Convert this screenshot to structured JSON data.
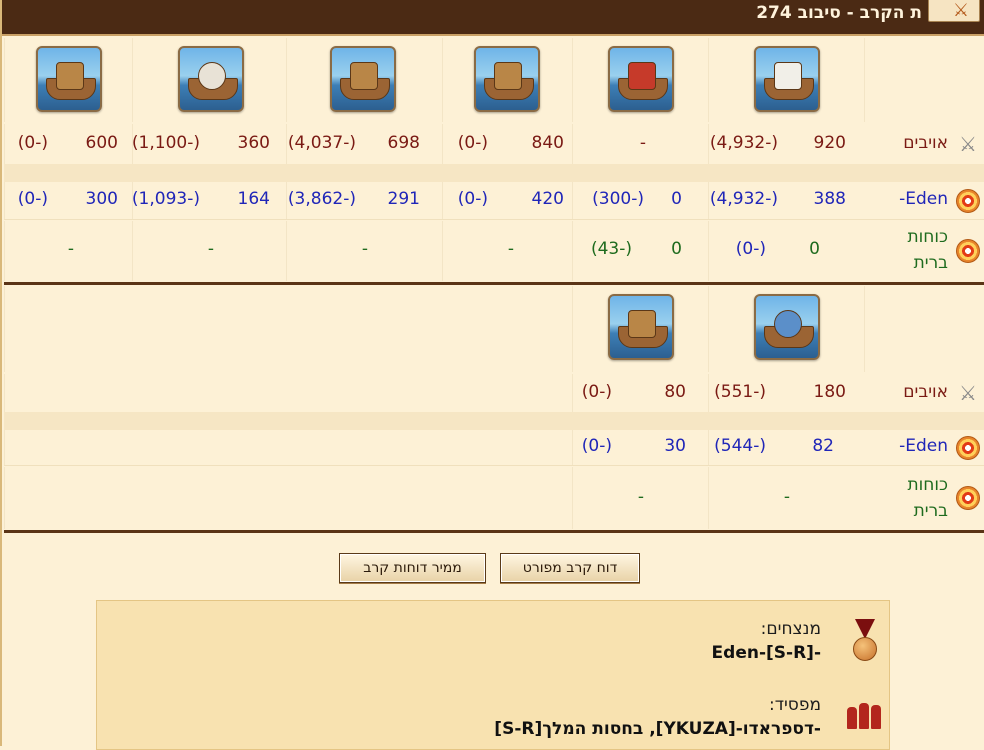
{
  "header": {
    "title": "ת הקרב - סיבוב 274",
    "corner_icon": "battle-icon"
  },
  "section1": {
    "units": [
      {
        "name": "unit-1",
        "icon": "ship-icon"
      },
      {
        "name": "unit-2",
        "icon": "flame-ship-icon"
      },
      {
        "name": "unit-3",
        "icon": "paddle-ship-icon"
      },
      {
        "name": "unit-4",
        "icon": "catapult-ship-icon"
      },
      {
        "name": "unit-5",
        "icon": "ballista-ship-icon"
      },
      {
        "name": "unit-6",
        "icon": "mortar-ship-icon"
      }
    ],
    "enemies": {
      "label": "אויבים",
      "cells": [
        {
          "a": "920",
          "b": "(4,932-)"
        },
        {
          "a": "",
          "b": "-"
        },
        {
          "a": "840",
          "b": "(0-)"
        },
        {
          "a": "698",
          "b": "(4,037-)"
        },
        {
          "a": "360",
          "b": "(1,100-)"
        },
        {
          "a": "600",
          "b": "(0-)"
        }
      ]
    },
    "eden": {
      "label": "Eden-",
      "cells": [
        {
          "a": "388",
          "b": "(4,932-)"
        },
        {
          "a": "0",
          "b": "(300-)"
        },
        {
          "a": "420",
          "b": "(0-)"
        },
        {
          "a": "291",
          "b": "(3,862-)"
        },
        {
          "a": "164",
          "b": "(1,093-)"
        },
        {
          "a": "300",
          "b": "(0-)"
        }
      ]
    },
    "allies": {
      "label_line1": "כוחות",
      "label_line2": "ברית",
      "cells": [
        {
          "a": "0",
          "b": "(0-)"
        },
        {
          "a": "0",
          "b": "(43-)"
        },
        {
          "a": "",
          "b": "-"
        },
        {
          "a": "",
          "b": "-"
        },
        {
          "a": "",
          "b": "-"
        },
        {
          "a": "",
          "b": "-"
        }
      ]
    }
  },
  "section2": {
    "units": [
      {
        "name": "unit-7",
        "icon": "balloon-ship-icon"
      },
      {
        "name": "unit-8",
        "icon": "crane-ship-icon"
      }
    ],
    "enemies": {
      "label": "אויבים",
      "cells": [
        {
          "a": "180",
          "b": "(551-)"
        },
        {
          "a": "80",
          "b": "(0-)"
        }
      ]
    },
    "eden": {
      "label": "Eden-",
      "cells": [
        {
          "a": "82",
          "b": "(544-)"
        },
        {
          "a": "30",
          "b": "(0-)"
        }
      ]
    },
    "allies": {
      "label_line1": "כוחות",
      "label_line2": "ברית",
      "cells": [
        {
          "a": "",
          "b": "-"
        },
        {
          "a": "",
          "b": "-"
        }
      ]
    }
  },
  "buttons": {
    "detailed": "דוח קרב מפורט",
    "converter": "ממיר דוחות קרב"
  },
  "result": {
    "winners_label": "מנצחים:",
    "winners_value": "-Eden-[S-R]",
    "loser_label": "מפסיד:",
    "loser_value": "-דספראדו-[YKUZA], בחסות המלך[S-R]"
  }
}
